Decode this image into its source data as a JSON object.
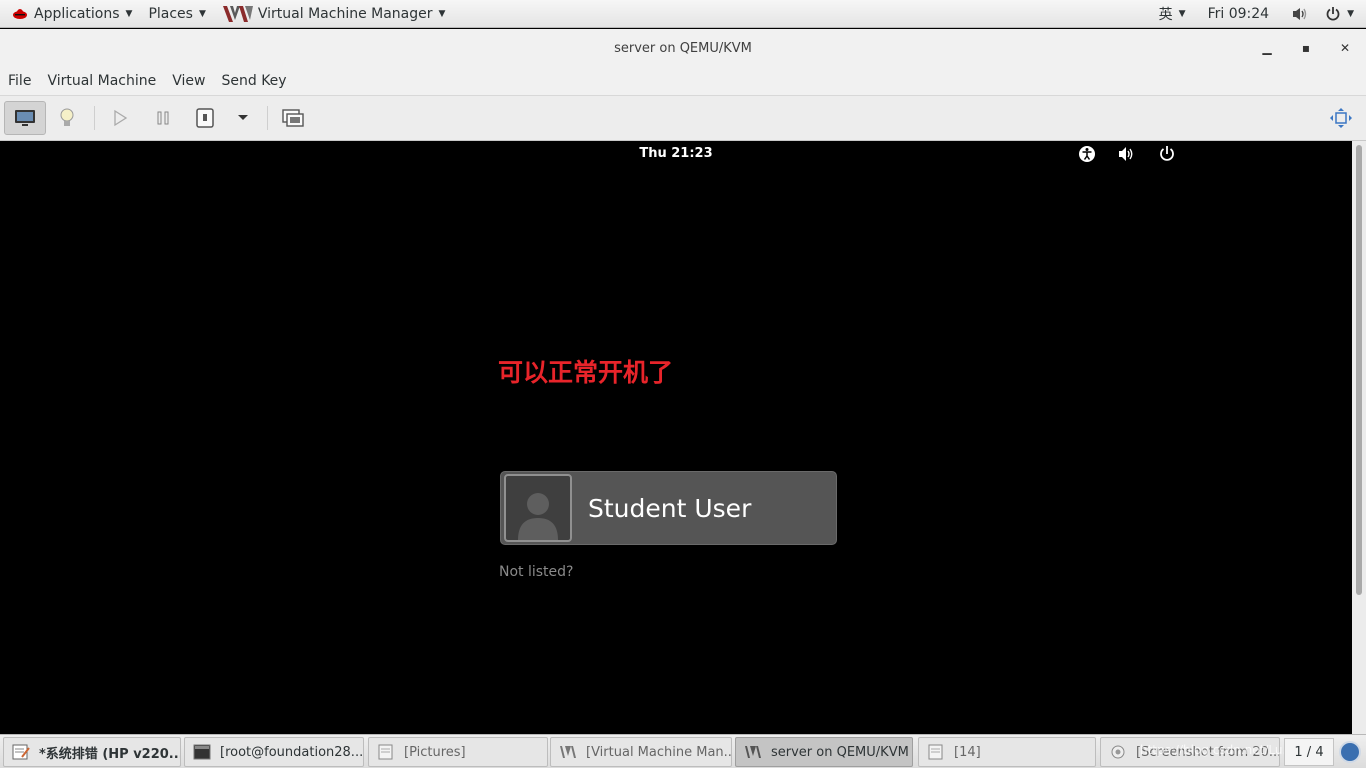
{
  "topbar": {
    "applications": "Applications",
    "places": "Places",
    "app_menu": "Virtual Machine Manager",
    "input_method": "英",
    "clock": "Fri 09:24"
  },
  "window": {
    "title": "server on QEMU/KVM",
    "menu": [
      "File",
      "Virtual Machine",
      "View",
      "Send Key"
    ]
  },
  "guest": {
    "clock": "Thu 21:23",
    "annotation": "可以正常开机了",
    "user_name": "Student User",
    "not_listed": "Not listed?"
  },
  "taskbar": {
    "tasks": [
      "*系统排错 (HP v220...",
      "[root@foundation28...",
      "[Pictures]",
      "[Virtual Machine Man...",
      "server on QEMU/KVM",
      "[14]",
      "[Screenshot from 20..."
    ],
    "watermark": "https://blog.csdn.net/Lu...q...",
    "workspace": "1 / 4"
  },
  "colors": {
    "annotation": "#e8242a",
    "guest_bg": "#000000",
    "user_card": "#555555"
  }
}
